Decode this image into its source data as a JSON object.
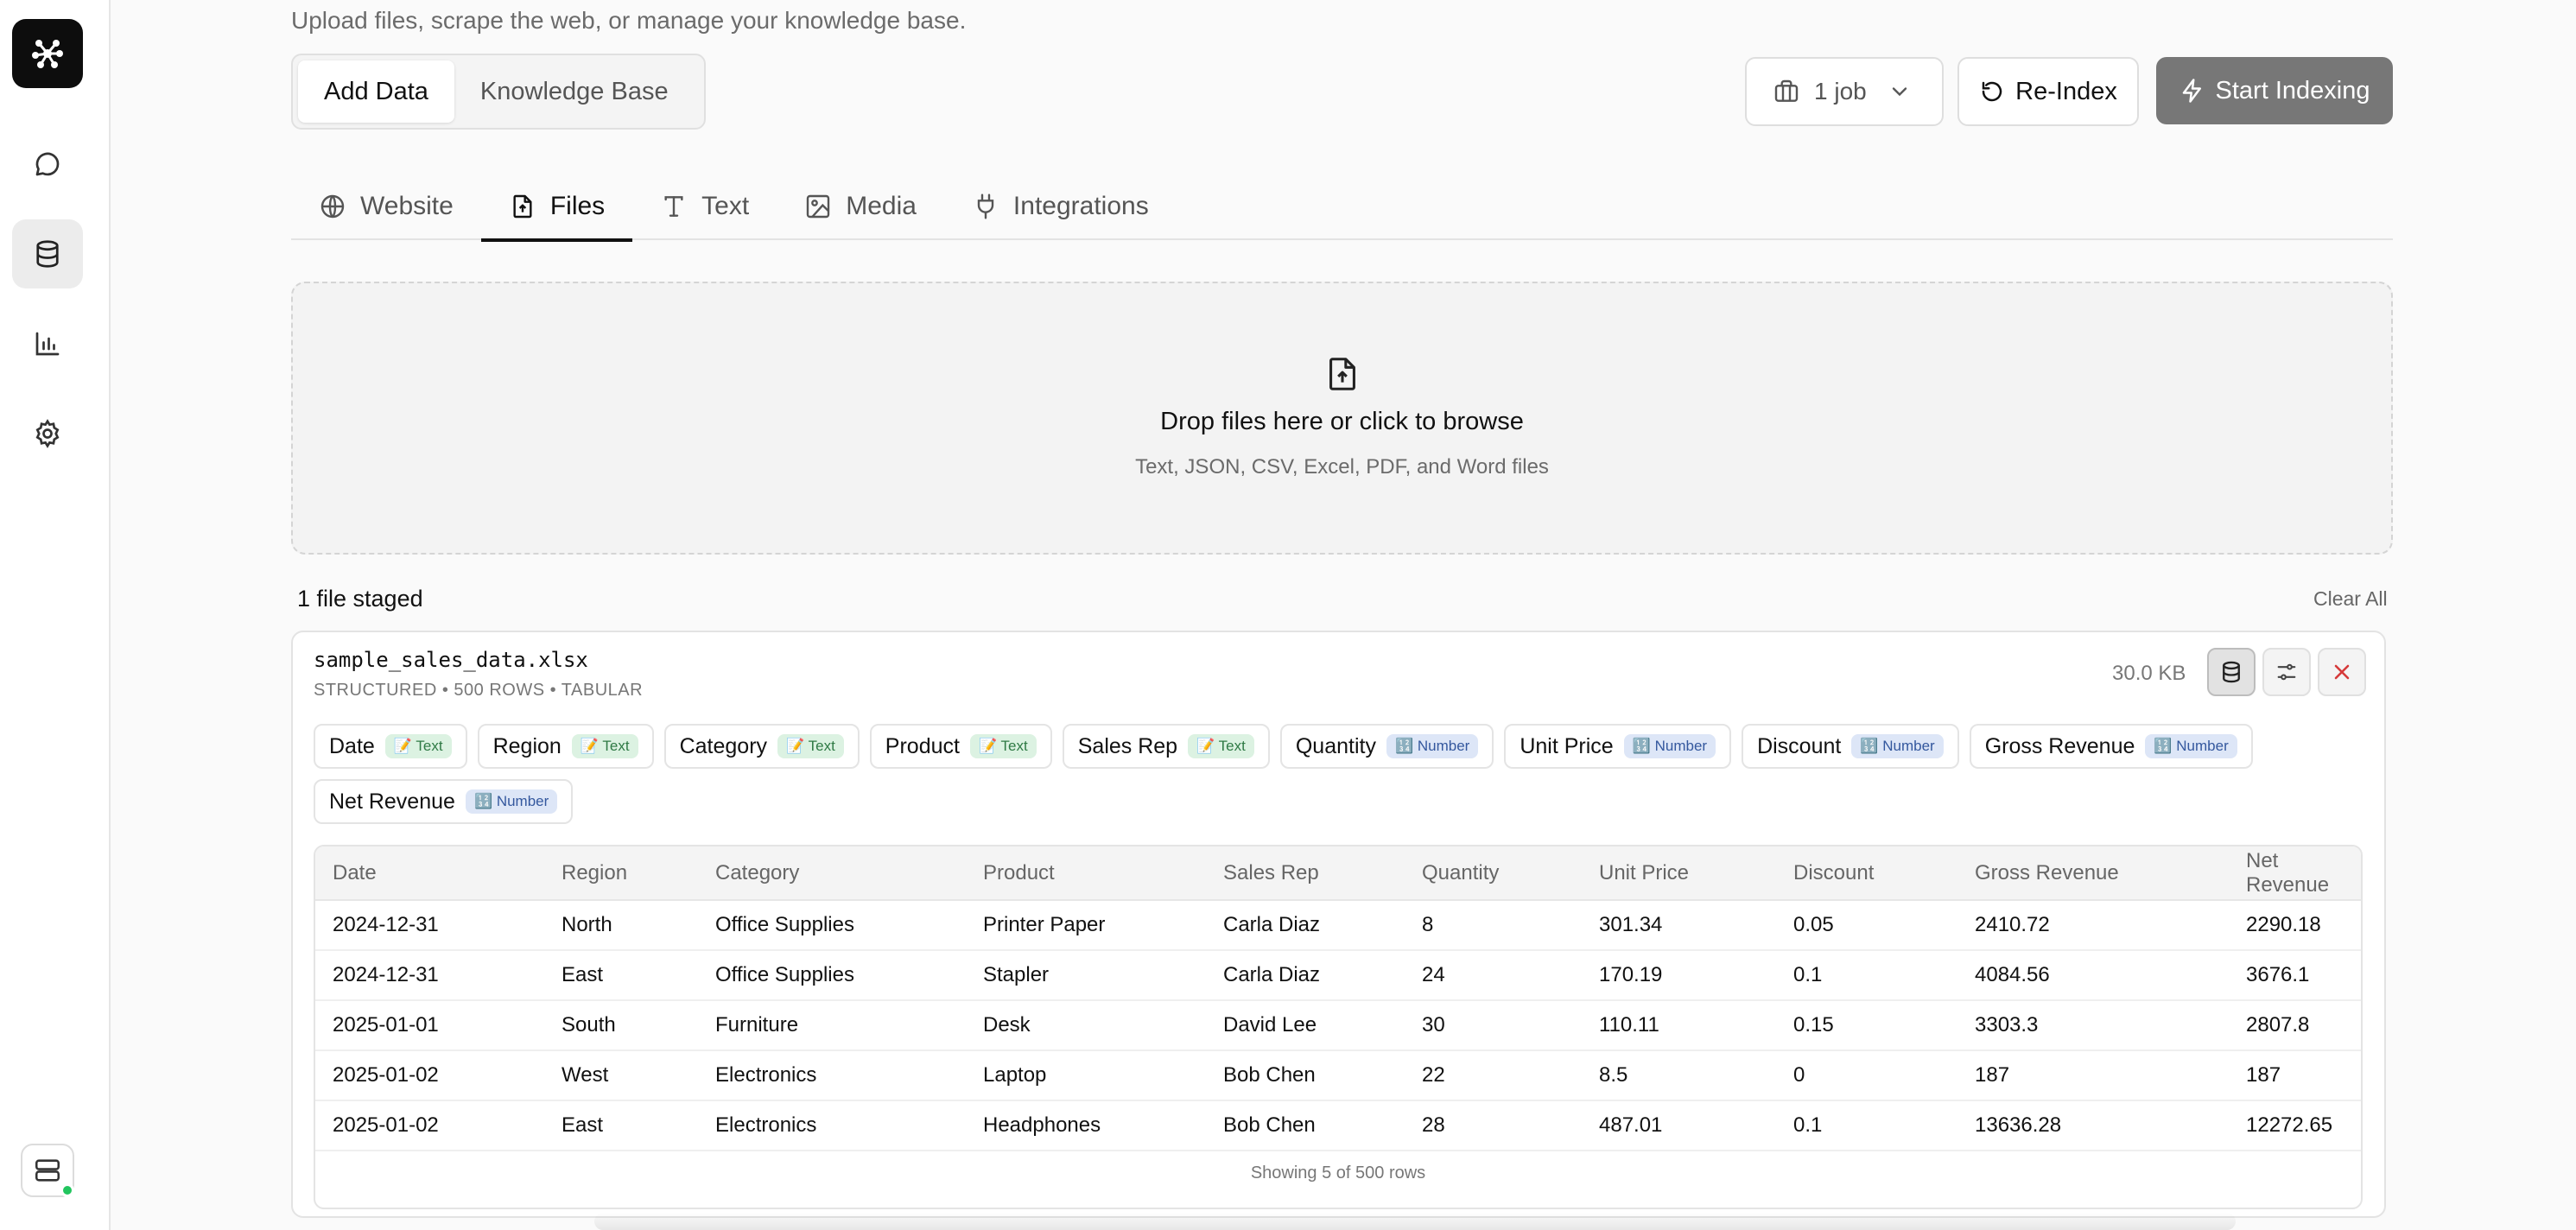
{
  "header": {
    "subtitle": "Upload files, scrape the web, or manage your knowledge base.",
    "segments": [
      "Add Data",
      "Knowledge Base"
    ],
    "job_label": "1 job",
    "reindex_label": "Re-Index",
    "start_label": "Start Indexing"
  },
  "tabs": [
    {
      "label": "Website",
      "icon": "globe-icon"
    },
    {
      "label": "Files",
      "icon": "file-upload-icon"
    },
    {
      "label": "Text",
      "icon": "type-icon"
    },
    {
      "label": "Media",
      "icon": "image-icon"
    },
    {
      "label": "Integrations",
      "icon": "plug-icon"
    }
  ],
  "dropzone": {
    "title": "Drop files here or click to browse",
    "subtitle": "Text, JSON, CSV, Excel, PDF, and Word files"
  },
  "staged": {
    "label": "1 file staged",
    "clear_label": "Clear All"
  },
  "file": {
    "name": "sample_sales_data.xlsx",
    "meta": "STRUCTURED • 500 ROWS • TABULAR",
    "size": "30.0 KB",
    "columns": [
      {
        "name": "Date",
        "type": "📝 Text",
        "kind": "text"
      },
      {
        "name": "Region",
        "type": "📝 Text",
        "kind": "text"
      },
      {
        "name": "Category",
        "type": "📝 Text",
        "kind": "text"
      },
      {
        "name": "Product",
        "type": "📝 Text",
        "kind": "text"
      },
      {
        "name": "Sales Rep",
        "type": "📝 Text",
        "kind": "text"
      },
      {
        "name": "Quantity",
        "type": "🔢 Number",
        "kind": "number"
      },
      {
        "name": "Unit Price",
        "type": "🔢 Number",
        "kind": "number"
      },
      {
        "name": "Discount",
        "type": "🔢 Number",
        "kind": "number"
      },
      {
        "name": "Gross Revenue",
        "type": "🔢 Number",
        "kind": "number"
      },
      {
        "name": "Net Revenue",
        "type": "🔢 Number",
        "kind": "number"
      }
    ],
    "preview_headers": [
      "Date",
      "Region",
      "Category",
      "Product",
      "Sales Rep",
      "Quantity",
      "Unit Price",
      "Discount",
      "Gross Revenue",
      "Net Revenue"
    ],
    "preview_rows": [
      [
        "2024-12-31",
        "North",
        "Office Supplies",
        "Printer Paper",
        "Carla Diaz",
        "8",
        "301.34",
        "0.05",
        "2410.72",
        "2290.18"
      ],
      [
        "2024-12-31",
        "East",
        "Office Supplies",
        "Stapler",
        "Carla Diaz",
        "24",
        "170.19",
        "0.1",
        "4084.56",
        "3676.1"
      ],
      [
        "2025-01-01",
        "South",
        "Furniture",
        "Desk",
        "David Lee",
        "30",
        "110.11",
        "0.15",
        "3303.3",
        "2807.8"
      ],
      [
        "2025-01-02",
        "West",
        "Electronics",
        "Laptop",
        "Bob Chen",
        "22",
        "8.5",
        "0",
        "187",
        "187"
      ],
      [
        "2025-01-02",
        "East",
        "Electronics",
        "Headphones",
        "Bob Chen",
        "28",
        "487.01",
        "0.1",
        "13636.28",
        "12272.65"
      ]
    ],
    "preview_footer": "Showing 5 of 500 rows"
  },
  "colors": {
    "status_online": "#22c55e",
    "start_button": "#777777",
    "close_icon": "#d63a3a"
  }
}
